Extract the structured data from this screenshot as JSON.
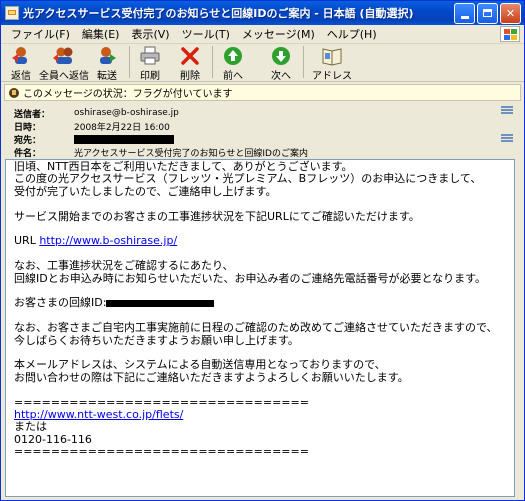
{
  "window": {
    "title": "光アクセスサービス受付完了のお知らせと回線IDのご案内 - 日本語 (自動選択)",
    "accent": "#0a5fe0"
  },
  "menu": [
    "ファイル(F)",
    "編集(E)",
    "表示(V)",
    "ツール(T)",
    "メッセージ(M)",
    "ヘルプ(H)"
  ],
  "toolbar": {
    "reply": "返信",
    "reply_all": "全員へ返信",
    "forward": "転送",
    "print": "印刷",
    "delete": "削除",
    "previous": "前へ",
    "next": "次へ",
    "address": "アドレス"
  },
  "status": "このメッセージの状況：フラグが付いています",
  "header": {
    "from_label": "送信者：",
    "from_value": "oshirase@b-oshirase.jp",
    "date_label": "日時：",
    "date_value": "2008年2月22日 16:00",
    "to_label": "宛先：",
    "subject_label": "件名：",
    "subject_value": "光アクセスサービス受付完了のお知らせと回線IDのご案内"
  },
  "body": {
    "line1": "旧頃、NTT西日本をご利用いただきまして、ありがとうございます。",
    "line2": "この度の光アクセスサービス（フレッツ・光プレミアム、Bフレッツ）のお申込につきまして、",
    "line3": "受付が完了いたしましたので、ご連絡申し上げます。",
    "line4": "サービス開始までのお客さまの工事進捗状況を下記URLにてご確認いただけます。",
    "url_prefix": "URL ",
    "url1": "http://www.b-oshirase.jp/",
    "line5": "なお、工事進捗状況をご確認するにあたり、",
    "line6": "回線IDとお申込み時にお知らせいただいた、お申込み者のご連絡先電話番号が必要となります。",
    "line7": "お客さまの回線ID:",
    "line8": "なお、お客さまご自宅内工事実施前に日程のご確認のため改めてご連絡させていただきますので、",
    "line9": "今しばらくお待ちいただきますようお願い申し上げます。",
    "line10": "本メールアドレスは、システムによる自動送信専用となっておりますので、",
    "line11": "お問い合わせの際は下記にご連絡いただきますようよろしくお願いいたします。",
    "separator": "================================",
    "url2": "http://www.ntt-west.co.jp/flets/",
    "or": "または",
    "phone": "0120-116-116"
  }
}
